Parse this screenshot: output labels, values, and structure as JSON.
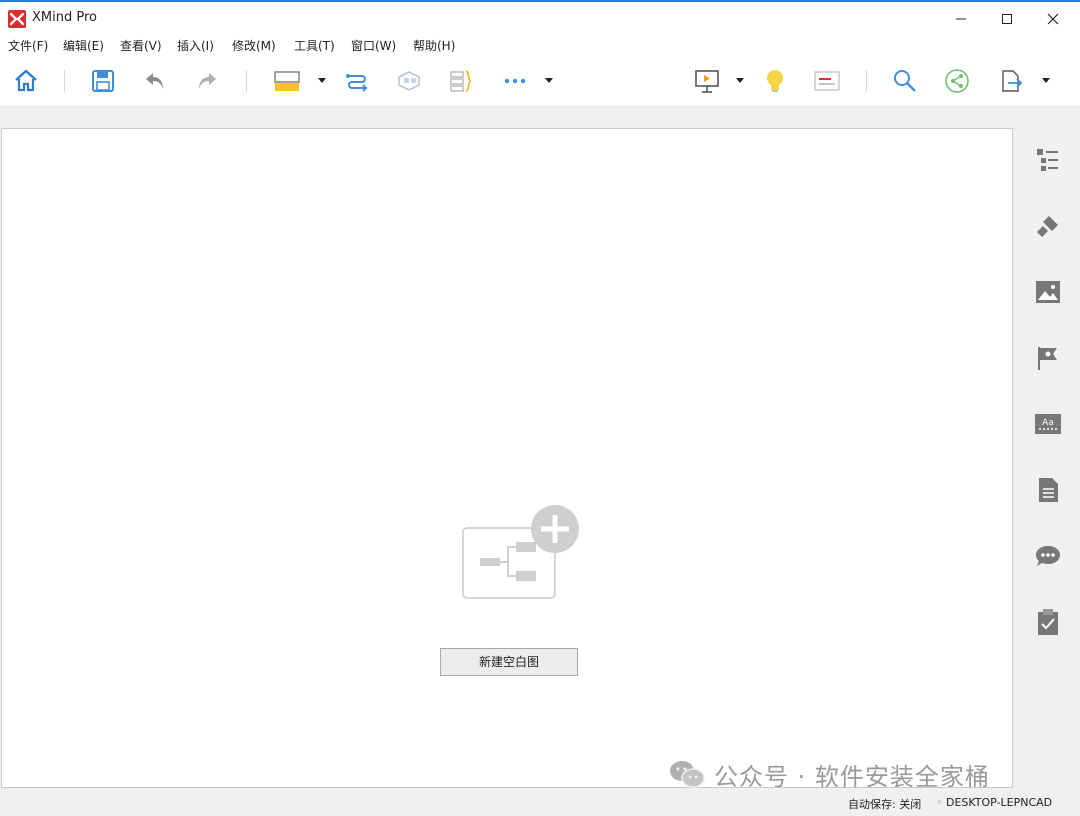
{
  "window": {
    "title": "XMind Pro",
    "accent": "#2d7dd2",
    "logo_color": "#e0282e"
  },
  "menu": [
    {
      "label": "文件(F)"
    },
    {
      "label": "编辑(E)"
    },
    {
      "label": "查看(V)"
    },
    {
      "label": "插入(I)"
    },
    {
      "label": "修改(M)"
    },
    {
      "label": "工具(T)"
    },
    {
      "label": "窗口(W)"
    },
    {
      "label": "帮助(H)"
    }
  ],
  "toolbar": {
    "icons": [
      "home-icon",
      "save-icon",
      "undo-icon",
      "redo-icon",
      "topic-icon",
      "relationship-icon",
      "boundary-icon",
      "summary-icon",
      "more-icon",
      "presentation-icon",
      "idea-icon",
      "gantt-icon",
      "search-icon",
      "share-icon",
      "export-icon"
    ]
  },
  "canvas": {
    "new_blank_label": "新建空白图"
  },
  "sidebar": {
    "icons": [
      "outline-icon",
      "format-icon",
      "image-icon",
      "marker-icon",
      "text-icon",
      "notes-icon",
      "comments-icon",
      "task-icon"
    ]
  },
  "watermark": {
    "text": "公众号 · 软件安装全家桶"
  },
  "status": {
    "autosave": "自动保存: 关闭",
    "host": "DESKTOP-LEPNCAD"
  }
}
